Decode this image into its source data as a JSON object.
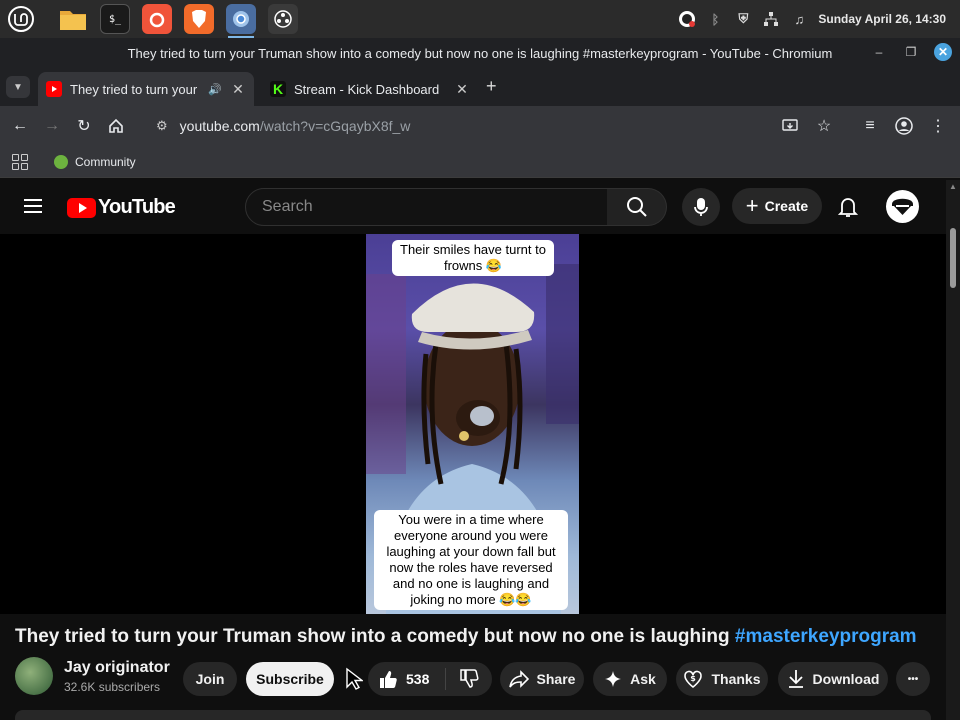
{
  "taskbar": {
    "apps": [
      {
        "icon": "linux-mint-menu-icon"
      },
      {
        "icon": "files-folder-icon"
      },
      {
        "icon": "terminal-icon",
        "label": "$_"
      },
      {
        "icon": "orange-browser-icon"
      },
      {
        "icon": "brave-browser-icon"
      },
      {
        "icon": "chromium-icon"
      },
      {
        "icon": "obs-icon"
      }
    ],
    "clock": "Sunday April 26, 14:30"
  },
  "window": {
    "title": "They tried to turn your Truman show into a comedy but now no one is laughing #masterkeyprogram - YouTube - Chromium"
  },
  "tabs": [
    {
      "title": "They tried to turn your Truman show",
      "favicon_color": "#ff0000",
      "active": true,
      "audio": true
    },
    {
      "title": "Stream - Kick Dashboard",
      "favicon_color": "#53fc18",
      "favicon_letter": "K",
      "active": false
    }
  ],
  "omnibox": {
    "url_host": "youtube.com",
    "url_path": "/watch?v=cGqaybX8f_w"
  },
  "bookmarks": [
    {
      "label": "Community"
    }
  ],
  "youtube": {
    "logo_text": "YouTube",
    "search_placeholder": "Search",
    "create_label": "Create"
  },
  "video": {
    "caption_top": "Their smiles have turnt to frowns 😂",
    "caption_bottom": "You were in a time where everyone around you were laughing at your down fall but now the roles have reversed and no one is laughing and joking no more 😂😂",
    "title_main": "They tried to turn your Truman show into a comedy but now no one is laughing ",
    "title_tag": "#masterkeyprogram"
  },
  "channel": {
    "name": "Jay originator",
    "subscribers": "32.6K subscribers"
  },
  "actions": {
    "join": "Join",
    "subscribe": "Subscribe",
    "likes": "538",
    "share": "Share",
    "ask": "Ask",
    "thanks": "Thanks",
    "download": "Download",
    "more": "•••"
  },
  "colors": {
    "yt_red": "#ff0000",
    "link_blue": "#3ea6ff",
    "bg": "#0f0f0f"
  }
}
